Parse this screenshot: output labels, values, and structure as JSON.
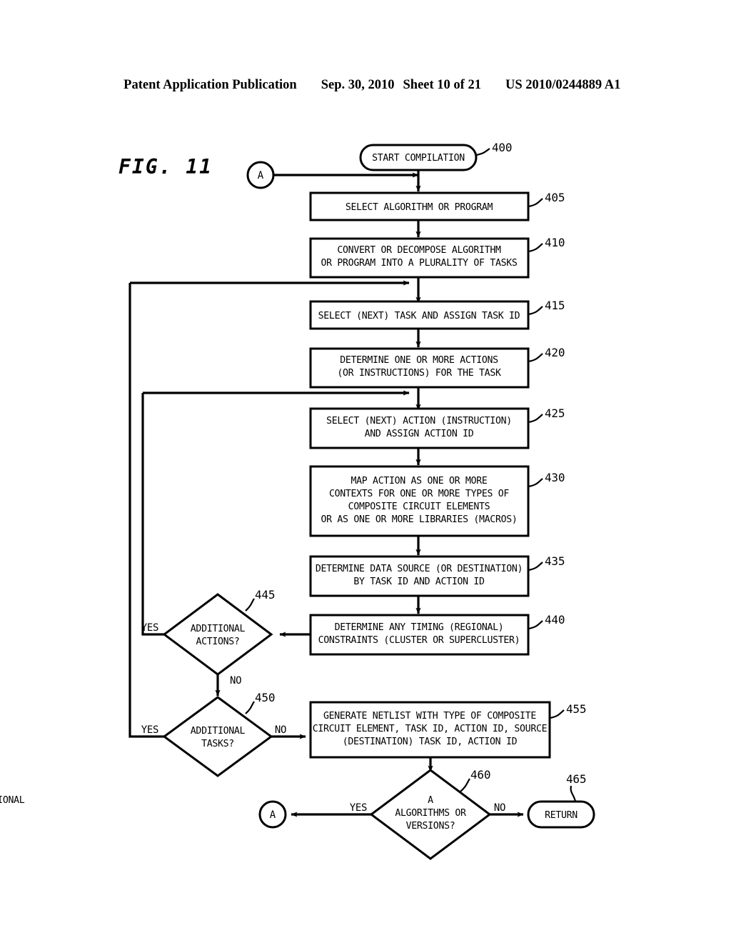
{
  "header": {
    "publication": "Patent Application Publication",
    "date": "Sep. 30, 2010",
    "sheet": "Sheet 10 of 21",
    "patent_number": "US 2010/0244889 A1"
  },
  "figure": {
    "label": "FIG. 11"
  },
  "connectors": {
    "top_a": "A",
    "bottom_a": "A"
  },
  "nodes": [
    {
      "ref": "400",
      "kind": "terminator",
      "lines": [
        "START COMPILATION"
      ]
    },
    {
      "ref": "405",
      "kind": "process",
      "lines": [
        "SELECT ALGORITHM OR PROGRAM"
      ]
    },
    {
      "ref": "410",
      "kind": "process",
      "lines": [
        "CONVERT OR DECOMPOSE ALGORITHM",
        "OR PROGRAM INTO A PLURALITY OF TASKS"
      ]
    },
    {
      "ref": "415",
      "kind": "process",
      "lines": [
        "SELECT (NEXT) TASK AND ASSIGN TASK ID"
      ]
    },
    {
      "ref": "420",
      "kind": "process",
      "lines": [
        "DETERMINE ONE OR MORE ACTIONS",
        "(OR INSTRUCTIONS) FOR THE TASK"
      ]
    },
    {
      "ref": "425",
      "kind": "process",
      "lines": [
        "SELECT (NEXT) ACTION (INSTRUCTION)",
        "AND ASSIGN ACTION ID"
      ]
    },
    {
      "ref": "430",
      "kind": "process",
      "lines": [
        "MAP ACTION AS ONE OR MORE",
        "CONTEXTS FOR ONE OR MORE TYPES OF",
        "COMPOSITE CIRCUIT ELEMENTS",
        "OR AS ONE OR MORE LIBRARIES (MACROS)"
      ]
    },
    {
      "ref": "435",
      "kind": "process",
      "lines": [
        "DETERMINE DATA SOURCE (OR DESTINATION)",
        "BY TASK ID AND ACTION ID"
      ]
    },
    {
      "ref": "440",
      "kind": "process",
      "lines": [
        "DETERMINE ANY TIMING (REGIONAL)",
        "CONSTRAINTS (CLUSTER OR SUPERCLUSTER)"
      ]
    },
    {
      "ref": "445",
      "kind": "decision",
      "lines": [
        "ADDITIONAL",
        "ACTIONS?"
      ],
      "yes_label": "YES",
      "no_label": "NO"
    },
    {
      "ref": "450",
      "kind": "decision",
      "lines": [
        "ADDITIONAL",
        "TASKS?"
      ],
      "yes_label": "YES",
      "no_label": "NO"
    },
    {
      "ref": "455",
      "kind": "process",
      "lines": [
        "GENERATE NETLIST WITH TYPE OF COMPOSITE",
        "CIRCUIT ELEMENT, TASK ID, ACTION ID, SOURCE",
        "(DESTINATION) TASK ID, ACTION ID"
      ]
    },
    {
      "ref": "460",
      "kind": "decision",
      "lines": [
        "ADDITIONAL",
        "ALGORITHMS OR",
        "VERSIONS?"
      ],
      "yes_label": "YES",
      "no_label": "NO"
    },
    {
      "ref": "465",
      "kind": "terminator",
      "lines": [
        "RETURN"
      ]
    }
  ],
  "refs": {
    "n400": "400",
    "n405": "405",
    "n410": "410",
    "n415": "415",
    "n420": "420",
    "n425": "425",
    "n430": "430",
    "n435": "435",
    "n440": "440",
    "n445": "445",
    "n450": "450",
    "n455": "455",
    "n460": "460",
    "n465": "465"
  },
  "text": {
    "t400_l1": "START COMPILATION",
    "t405_l1": "SELECT ALGORITHM OR PROGRAM",
    "t410_l1": "CONVERT OR DECOMPOSE ALGORITHM",
    "t410_l2": "OR PROGRAM INTO A PLURALITY OF TASKS",
    "t415_l1": "SELECT (NEXT) TASK AND ASSIGN TASK ID",
    "t420_l1": "DETERMINE ONE OR MORE ACTIONS",
    "t420_l2": "(OR INSTRUCTIONS) FOR THE TASK",
    "t425_l1": "SELECT (NEXT) ACTION (INSTRUCTION)",
    "t425_l2": "AND ASSIGN ACTION ID",
    "t430_l1": "MAP ACTION AS ONE OR MORE",
    "t430_l2": "CONTEXTS FOR ONE OR MORE TYPES OF",
    "t430_l3": "COMPOSITE CIRCUIT ELEMENTS",
    "t430_l4": "OR AS ONE OR MORE LIBRARIES (MACROS)",
    "t435_l1": "DETERMINE DATA SOURCE (OR DESTINATION)",
    "t435_l2": "BY TASK ID AND ACTION ID",
    "t440_l1": "DETERMINE ANY TIMING (REGIONAL)",
    "t440_l2": "CONSTRAINTS (CLUSTER OR SUPERCLUSTER)",
    "t445_l1": "ADDITIONAL",
    "t445_l2": "ACTIONS?",
    "t450_l1": "ADDITIONAL",
    "t450_l2": "TASKS?",
    "t455_l1": "GENERATE NETLIST WITH TYPE OF COMPOSITE",
    "t455_l2": "CIRCUIT ELEMENT, TASK ID, ACTION ID, SOURCE",
    "t455_l3": "(DESTINATION) TASK ID, ACTION ID",
    "t460_l1": "ADDITIONAL",
    "t460_l2": "ALGORITHMS OR",
    "t460_l3": "VERSIONS?",
    "t465_l1": "RETURN",
    "yes445": "YES",
    "no445": "NO",
    "yes450": "YES",
    "no450": "NO",
    "yes460": "YES",
    "no460": "NO",
    "connA_top": "A",
    "connA_bottom": "A"
  },
  "colors": {
    "ink": "#000000",
    "paper": "#ffffff"
  }
}
